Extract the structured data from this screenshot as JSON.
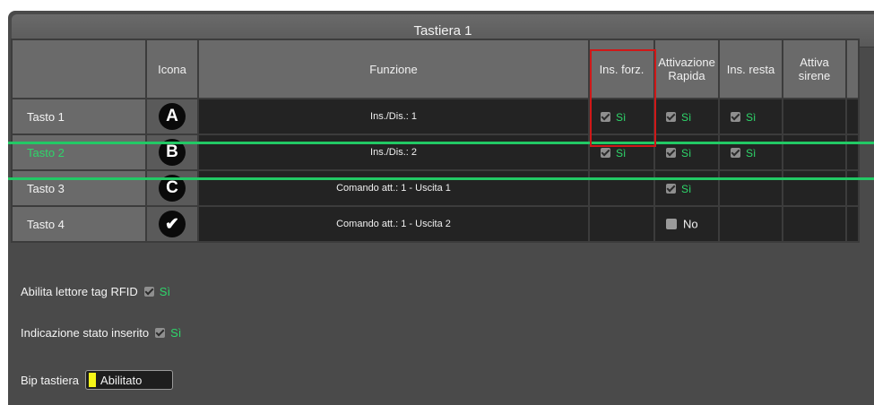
{
  "title": "Tastiera 1",
  "headers": {
    "icona": "Icona",
    "funzione": "Funzione",
    "ins_forz": "Ins. forz.",
    "attivazione_1": "Attivazione",
    "attivazione_2": "Rapida",
    "ins_resta": "Ins. resta",
    "attiva_1": "Attiva",
    "attiva_2": "sirene"
  },
  "rows": [
    {
      "name": "Tasto 1",
      "icon": "A",
      "funzione": "Ins./Dis.: 1",
      "ins_forz": "Sì",
      "attivazione": "Sì",
      "ins_resta": "Sì"
    },
    {
      "name": "Tasto 2",
      "icon": "B",
      "funzione": "Ins./Dis.: 2",
      "ins_forz": "Sì",
      "attivazione": "Sì",
      "ins_resta": "Sì"
    },
    {
      "name": "Tasto 3",
      "icon": "C",
      "funzione": "Comando att.: 1 - Uscita 1",
      "attivazione": "Sì"
    },
    {
      "name": "Tasto 4",
      "icon": "check-mark",
      "funzione": "Comando att.: 1 - Uscita 2",
      "attivazione": "No"
    }
  ],
  "settings": {
    "rfid_label": "Abilita lettore tag RFID",
    "rfid_value": "Sì",
    "stato_label": "Indicazione stato inserito",
    "stato_value": "Sì",
    "bip_label": "Bip tastiera",
    "bip_value": "Abilitato"
  },
  "colors": {
    "accent_green": "#2ed66a",
    "highlight_red": "#d01818",
    "bip_yellow": "#f5f518",
    "panel_bg": "#4a4a4a"
  }
}
